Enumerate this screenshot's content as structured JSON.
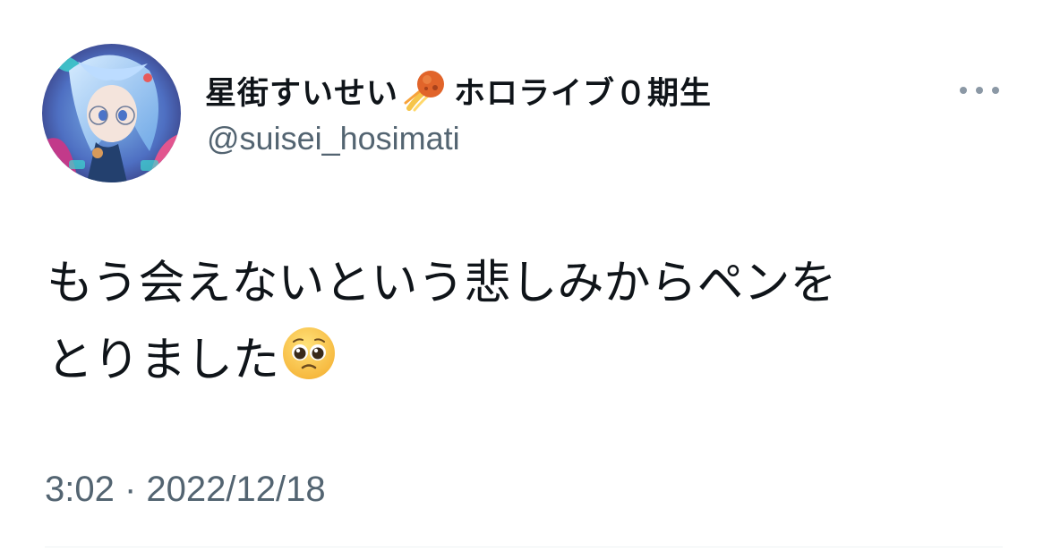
{
  "tweet": {
    "author": {
      "display_name": "星街すいせい",
      "name_badge_icon": "comet-icon",
      "name_suffix": "ホロライブ０期生",
      "handle": "@suisei_hosimati",
      "avatar_icon": "avatar-illustration"
    },
    "more_icon": "more-horizontal-icon",
    "text_lines": [
      "もう会えないという悲しみからペンを",
      "とりました"
    ],
    "text_emoji": "pleading-face-emoji",
    "timestamp": "3:02 · 2022/12/18"
  },
  "colors": {
    "text_primary": "#0f1419",
    "text_secondary": "#536471",
    "divider": "#eff3f4"
  }
}
